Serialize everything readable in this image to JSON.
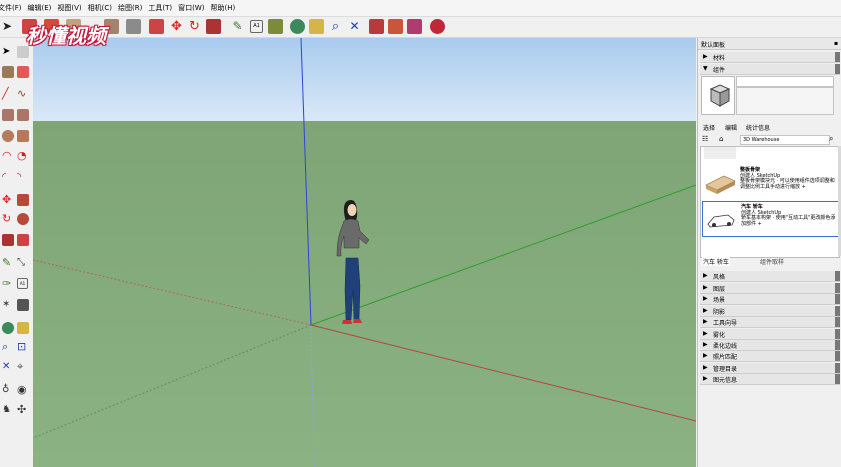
{
  "menu": [
    "文件(F)",
    "编辑(E)",
    "视图(V)",
    "相机(C)",
    "绘图(R)",
    "工具(T)",
    "窗口(W)",
    "帮助(H)"
  ],
  "watermark": "秒懂视频",
  "panel": {
    "title": "默认面板",
    "materials": "材料",
    "components": "组件",
    "tabs": [
      "选择",
      "编辑",
      "统计信息"
    ],
    "search_value": "3D Warehouse",
    "items": [
      {
        "title": "整板骨架",
        "author": "创建人 SketchUp",
        "desc": "整板骨架模块元 · 可以使用组件选项调整和调整比例工具手动进行缩放 +"
      },
      {
        "title": "汽车 轿车",
        "author": "创建人 SketchUp",
        "desc": "轿车基本构架 · 使用\"互动工具\"更改颜色添加部件 +"
      }
    ],
    "breadcrumb": "汽车 轿车",
    "breadcrumb_right": "组件取样",
    "sections": [
      "风格",
      "图层",
      "场景",
      "阴影",
      "工具向导",
      "雾化",
      "柔化边线",
      "照片匹配",
      "管理目录",
      "图元信息"
    ]
  },
  "colors": {
    "sky_top": "#a9cbee",
    "ground": "#84ab7c",
    "axis_blue": "#2b45d8",
    "axis_green": "#2f9d2c",
    "axis_red": "#b8413f"
  }
}
